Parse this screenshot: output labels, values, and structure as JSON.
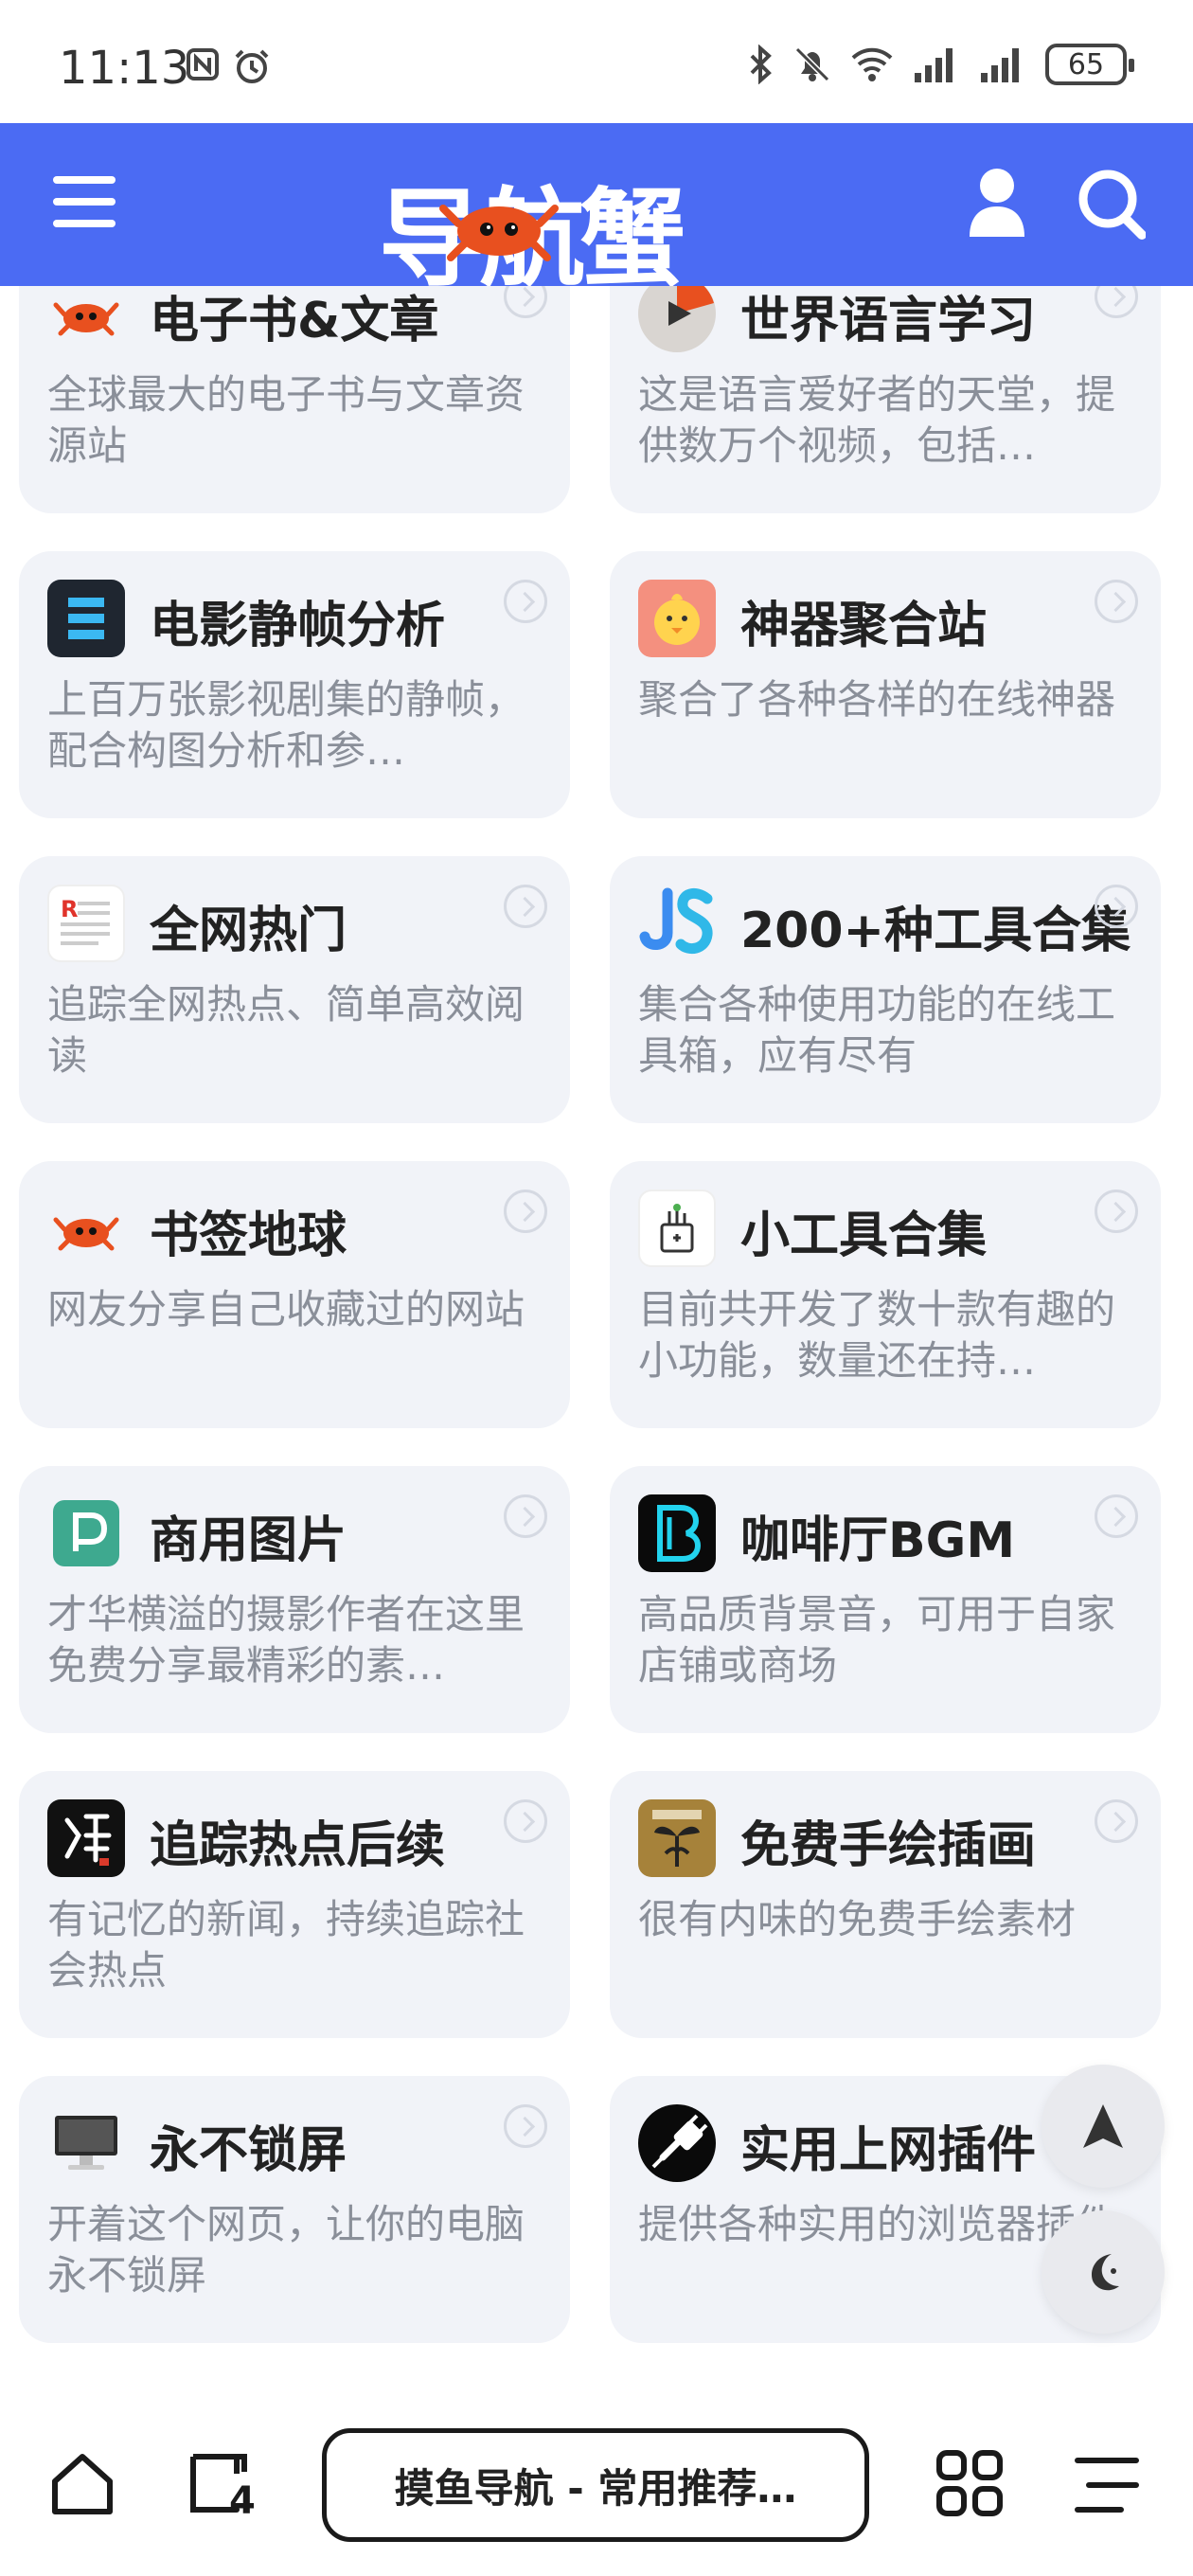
{
  "status_bar": {
    "time": "11:13",
    "battery": "65",
    "left_icons": [
      "nfc-icon",
      "alarm-icon"
    ],
    "right_icons": [
      "bluetooth-icon",
      "mute-icon",
      "wifi-icon",
      "signal-icon",
      "signal-icon"
    ]
  },
  "header": {
    "logo_text": "导航蟹",
    "accent_color": "#4B6BF3"
  },
  "cards": [
    {
      "title": "电子书&文章",
      "desc": "全球最大的电子书与文章资源站",
      "icon": "crab-icon"
    },
    {
      "title": "世界语言学习",
      "desc": "这是语言爱好者的天堂，提供数万个视频，包括…",
      "icon": "video-globe-icon"
    },
    {
      "title": "电影静帧分析",
      "desc": "上百万张影视剧集的静帧，配合构图分析和参…",
      "icon": "film-frame-icon"
    },
    {
      "title": "神器聚合站",
      "desc": "聚合了各种各样的在线神器",
      "icon": "chick-icon"
    },
    {
      "title": "全网热门",
      "desc": "追踪全网热点、简单高效阅读",
      "icon": "news-icon"
    },
    {
      "title": "200+种工具合集",
      "desc": "集合各种使用功能的在线工具箱，应有尽有",
      "icon": "js-icon"
    },
    {
      "title": "书签地球",
      "desc": "网友分享自己收藏过的网站",
      "icon": "crab-icon"
    },
    {
      "title": "小工具合集",
      "desc": "目前共开发了数十款有趣的小功能，数量还在持…",
      "icon": "tool-box-icon"
    },
    {
      "title": "商用图片",
      "desc": "才华横溢的摄影作者在这里免费分享最精彩的素…",
      "icon": "pexels-icon"
    },
    {
      "title": "咖啡厅BGM",
      "desc": "高品质背景音，可用于自家店铺或商场",
      "icon": "b-logo-icon"
    },
    {
      "title": "追踪热点后续",
      "desc": "有记忆的新闻，持续追踪社会热点",
      "icon": "calligraphy-icon"
    },
    {
      "title": "免费手绘插画",
      "desc": "很有内味的免费手绘素材",
      "icon": "irasutoya-icon"
    },
    {
      "title": "永不锁屏",
      "desc": "开着这个网页，让你的电脑永不锁屏",
      "icon": "monitor-icon"
    },
    {
      "title": "实用上网插件",
      "desc": "提供各种实用的浏览器插件",
      "icon": "plug-icon"
    }
  ],
  "bottom_bar": {
    "url_text": "摸鱼导航 - 常用推荐…",
    "tab_count": "4"
  }
}
